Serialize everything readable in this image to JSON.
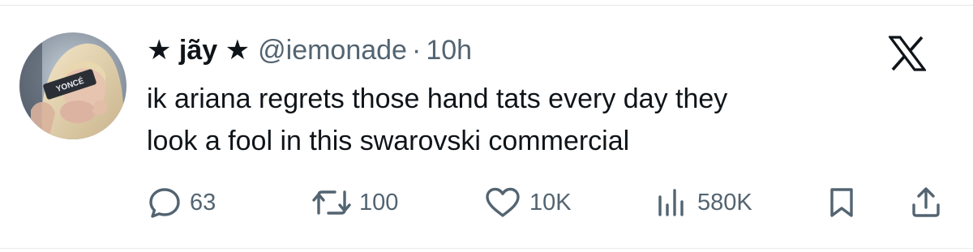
{
  "tweet": {
    "author": {
      "display_name": "★ jãy ★",
      "handle": "@iemonade",
      "avatar_badge": "YONCÉ"
    },
    "separator": "·",
    "timestamp": "10h",
    "text_lines": [
      "ik ariana regrets those hand tats every day they",
      "look a fool in this swarovski commercial"
    ],
    "metrics": {
      "replies": "63",
      "reposts": "100",
      "likes": "10K",
      "views": "580K"
    }
  },
  "icons": {
    "brand": "x-logo-icon",
    "reply": "speech-bubble-icon",
    "repost": "repost-arrows-icon",
    "like": "heart-icon",
    "views": "bar-chart-icon",
    "bookmark": "bookmark-icon",
    "share": "share-upload-icon"
  },
  "colors": {
    "text_primary": "#0f1419",
    "text_secondary": "#536471",
    "background": "#ffffff"
  }
}
